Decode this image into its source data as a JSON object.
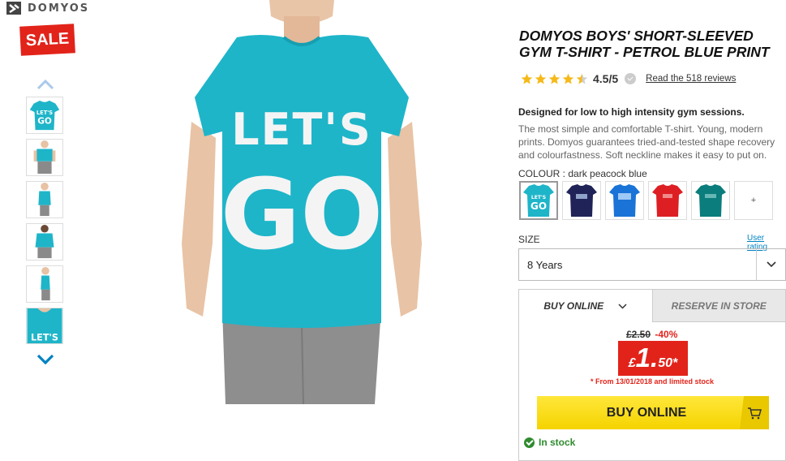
{
  "brand": {
    "name": "DOMYOS",
    "logo_icon": "domyos-logo-icon"
  },
  "badge": {
    "sale": "SALE"
  },
  "gallery": {
    "thumbnails": [
      "front",
      "model-front",
      "model-side",
      "model-back",
      "model-profile",
      "print-closeup"
    ],
    "up_icon": "chevron-up-icon",
    "down_icon": "chevron-down-icon",
    "main_print_line1": "LET'S",
    "main_print_line2": "GO"
  },
  "product": {
    "title": "DOMYOS BOYS' SHORT-SLEEVED GYM T-SHIRT - PETROL BLUE PRINT",
    "rating_stars": 4.5,
    "rating_text": "4.5/5",
    "reviews_link": "Read the 518 reviews",
    "tagline": "Designed for low to high intensity gym sessions.",
    "description": "The most simple and comfortable T-shirt. Young, modern prints. Domyos guarantees tried-and-tested shape recovery and colourfastness. Soft neckline makes it easy to put on.",
    "colour_label": "COLOUR : ",
    "colour_value": "dark peacock blue",
    "swatches": [
      {
        "name": "dark peacock blue",
        "color": "#1eb5c9"
      },
      {
        "name": "navy",
        "color": "#1f2357"
      },
      {
        "name": "blue",
        "color": "#1a73d6"
      },
      {
        "name": "red",
        "color": "#dd1f24"
      },
      {
        "name": "petrol",
        "color": "#0a7d7c"
      }
    ],
    "more_swatches": "+"
  },
  "size": {
    "label": "SIZE",
    "guide_link": "User rating",
    "selected": "8 Years"
  },
  "purchase": {
    "tab_online": "BUY ONLINE",
    "tab_store": "RESERVE IN STORE",
    "old_price": "£2.50",
    "discount": "-40%",
    "price_currency": "£",
    "price_integer": "1.",
    "price_decimal": "50*",
    "promo_note": "* From 13/01/2018 and limited stock",
    "buy_button": "BUY ONLINE",
    "stock_status": "In stock"
  },
  "colors": {
    "sale_red": "#e2231a",
    "buy_yellow": "#f5d300",
    "shirt_teal": "#1eb5c9",
    "link_blue": "#0082c3",
    "stock_green": "#2f8b2f"
  }
}
